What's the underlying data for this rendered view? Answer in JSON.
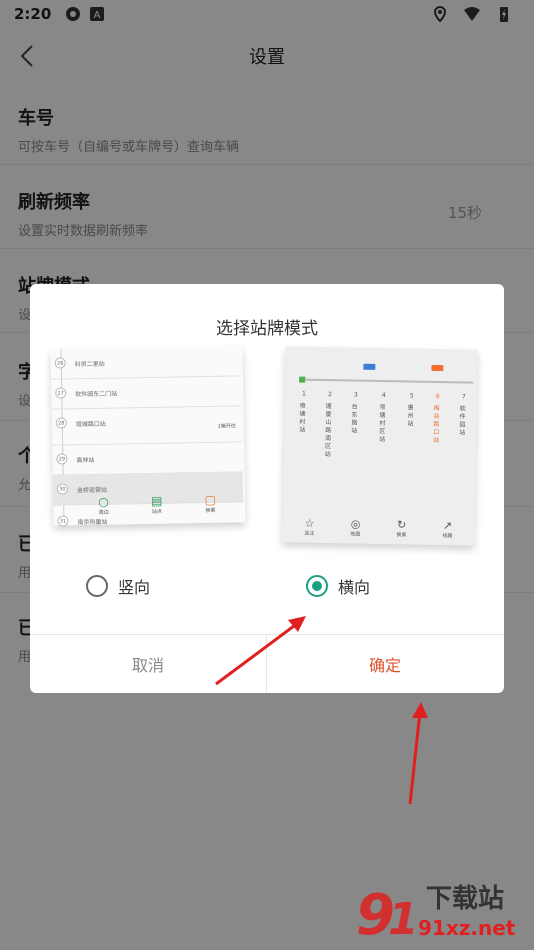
{
  "status_bar": {
    "time": "2:20"
  },
  "app_bar": {
    "title": "设置"
  },
  "settings": [
    {
      "title": "车号",
      "subtitle": "可按车号（自编号或车牌号）查询车辆",
      "value": ""
    },
    {
      "title": "刷新频率",
      "subtitle": "设置实时数据刷新频率",
      "value": "15秒"
    },
    {
      "title": "站牌模式",
      "subtitle": "设",
      "value": ""
    },
    {
      "title": "字",
      "subtitle": "设",
      "value": ""
    },
    {
      "title": "个",
      "subtitle": "允",
      "value": ""
    },
    {
      "title": "已",
      "subtitle": "用",
      "value": ""
    },
    {
      "title": "已",
      "subtitle": "用",
      "value": ""
    }
  ],
  "dialog": {
    "title": "选择站牌模式",
    "vertical_preview": {
      "stations": [
        "科贸二里站",
        "软件园东二门站",
        "塔城路口站",
        "高林站",
        "金桥运营站",
        "南京热量站"
      ],
      "tabs": [
        "周边",
        "站点",
        "换乘"
      ],
      "bus_tag": "1辆开往"
    },
    "horizontal_preview": {
      "stations": [
        "喷塘村站",
        "塘厦山路南区站",
        "台东路站",
        "坝塘村区站",
        "惠州站",
        "梅谷路口站",
        "软件园站"
      ],
      "numbers": [
        "1",
        "2",
        "3",
        "4",
        "5",
        "6",
        "7"
      ],
      "tabs": [
        "关注",
        "地图",
        "换乘",
        "线路"
      ]
    },
    "options": [
      {
        "label": "竖向",
        "checked": false
      },
      {
        "label": "横向",
        "checked": true
      }
    ],
    "cancel_label": "取消",
    "confirm_label": "确定"
  },
  "watermark": {
    "text": "91xz.net",
    "brand": "下载站"
  },
  "colors": {
    "accent": "#1aa080",
    "confirm": "#e0502a",
    "arrow": "#e02020"
  }
}
